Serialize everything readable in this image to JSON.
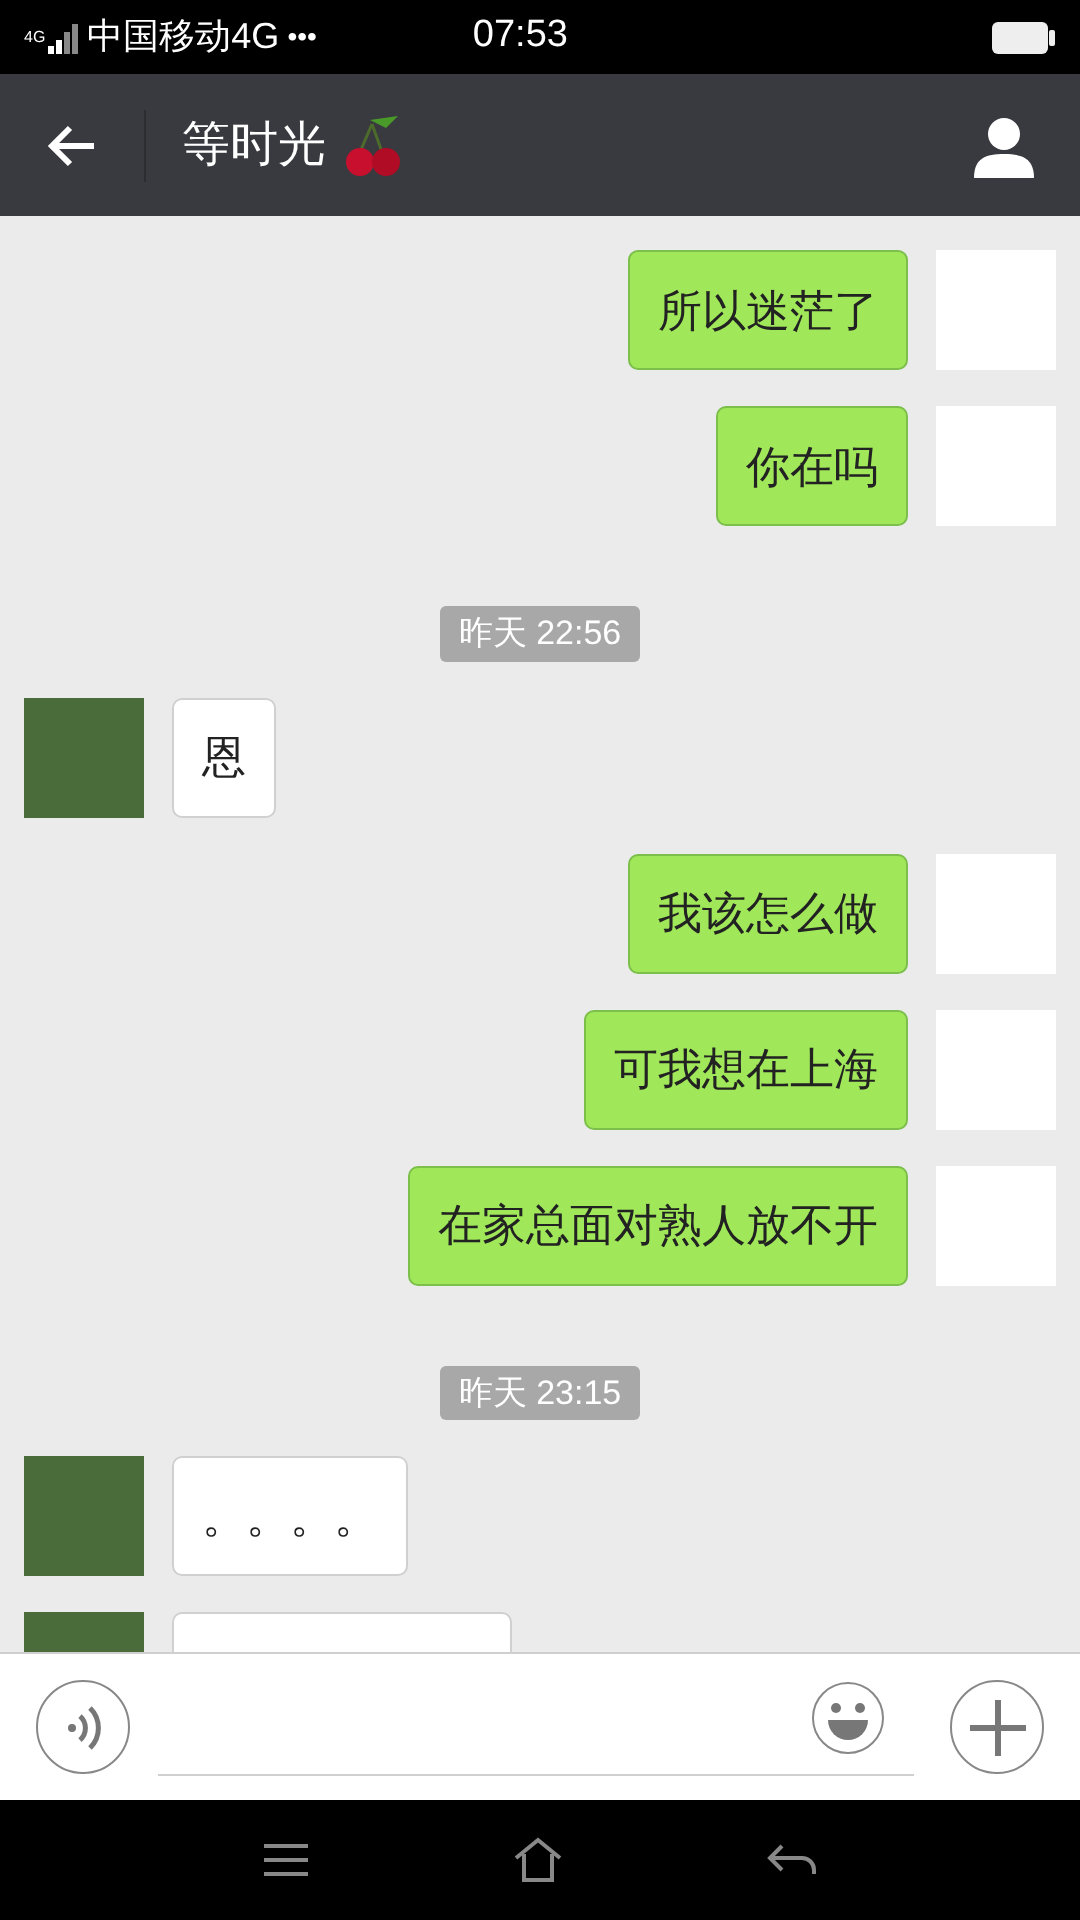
{
  "status_bar": {
    "network": "4G",
    "carrier": "中国移动4G",
    "more": "•••",
    "time": "07:53"
  },
  "header": {
    "title": "等时光"
  },
  "messages": [
    {
      "kind": "outgoing",
      "text": "所以迷茫了"
    },
    {
      "kind": "outgoing",
      "text": "你在吗"
    },
    {
      "kind": "timestamp",
      "text": "昨天 22:56"
    },
    {
      "kind": "incoming",
      "text": "恩"
    },
    {
      "kind": "outgoing",
      "text": "我该怎么做"
    },
    {
      "kind": "outgoing",
      "text": "可我想在上海"
    },
    {
      "kind": "outgoing",
      "text": "在家总面对熟人放不开"
    },
    {
      "kind": "timestamp",
      "text": "昨天 23:15"
    },
    {
      "kind": "incoming",
      "text": "。。。。"
    },
    {
      "kind": "incoming"
    }
  ]
}
